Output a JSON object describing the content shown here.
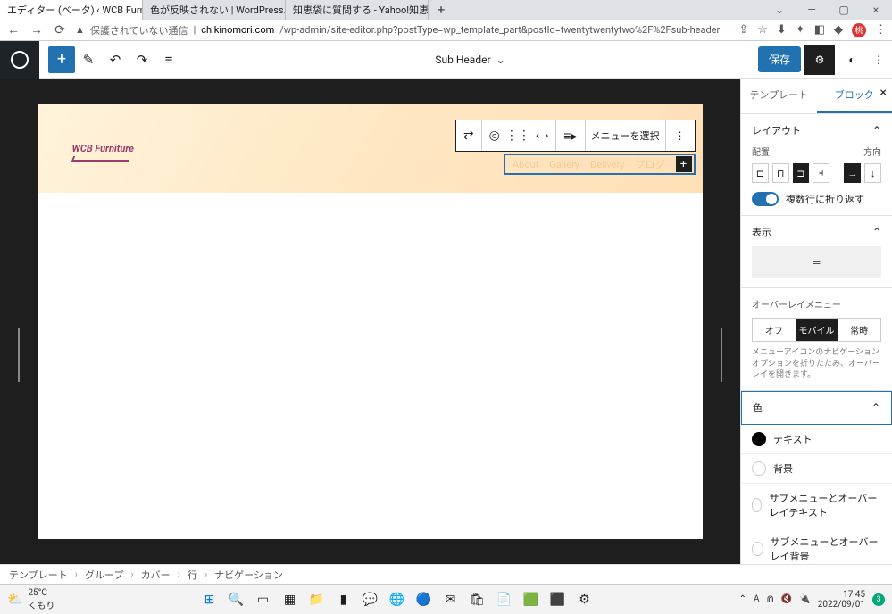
{
  "browser": {
    "tabs": [
      {
        "title": "エディター (ベータ) ‹ WCB Furniture",
        "active": true
      },
      {
        "title": "色が反映されない | WordPress.org",
        "active": false
      },
      {
        "title": "知恵袋に質問する - Yahoo!知恵袋",
        "active": false
      }
    ],
    "url_insecure": "保護されていない通信",
    "url_domain": "chikinomori.com",
    "url_path": "/wp-admin/site-editor.php?postType=wp_template_part&postId=twentytwentytwo%2F%2Fsub-header"
  },
  "wp": {
    "doc_title": "Sub Header",
    "save": "保存"
  },
  "canvas": {
    "logo_text": "WCB Furniture",
    "toolbar_select": "メニューを選択",
    "nav_items": [
      "About",
      "Gallery",
      "Delivery",
      "ブログ"
    ]
  },
  "sidebar": {
    "tab_template": "テンプレート",
    "tab_block": "ブロック",
    "layout": {
      "title": "レイアウト",
      "align_label": "配置",
      "direction_label": "方向",
      "wrap_label": "複数行に折り返す"
    },
    "display": {
      "title": "表示"
    },
    "overlay": {
      "title": "オーバーレイメニュー",
      "off": "オフ",
      "mobile": "モバイル",
      "always": "常時",
      "help": "メニューアイコンのナビゲーションオプションを折りたたみ、オーバーレイを開きます。"
    },
    "color": {
      "title": "色",
      "text": "テキスト",
      "bg": "背景",
      "submenu_text": "サブメニューとオーバーレイテキスト",
      "submenu_bg": "サブメニューとオーバーレイ背景"
    }
  },
  "breadcrumb": [
    "テンプレート",
    "グループ",
    "カバー",
    "行",
    "ナビゲーション"
  ],
  "taskbar": {
    "temp": "25°C",
    "weather": "くもり",
    "time": "17:45",
    "date": "2022/09/01"
  }
}
